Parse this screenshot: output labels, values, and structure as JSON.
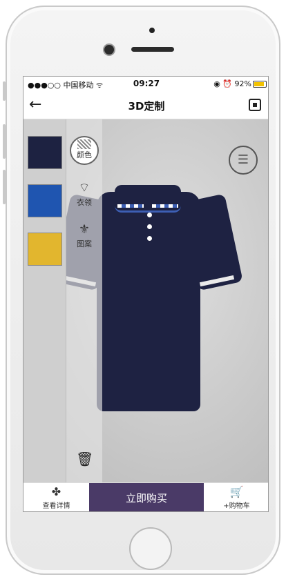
{
  "status_bar": {
    "carrier": "●●●○○ 中国移动 ᯤ",
    "time": "09:27",
    "right": "◉ ⏰ 92%"
  },
  "nav": {
    "back_icon": "←",
    "title": "3D定制"
  },
  "swatches": [
    {
      "name": "navy",
      "color": "#1d2241"
    },
    {
      "name": "blue",
      "color": "#1f55b0"
    },
    {
      "name": "yellow",
      "color": "#e2b62e"
    }
  ],
  "tools": {
    "color_label": "颜色",
    "collar_label": "衣领",
    "collar_icon": "⌔",
    "pattern_label": "图案",
    "pattern_icon": "⚜",
    "trash_icon": "🗑"
  },
  "bottom_bar": {
    "detail_icon": "✤",
    "detail_label": "查看详情",
    "buy_label": "立即购买",
    "cart_icon": "🛒",
    "cart_label": "+购物车"
  },
  "colors": {
    "accent": "#4a3a67",
    "shirt": "#1e2242"
  }
}
